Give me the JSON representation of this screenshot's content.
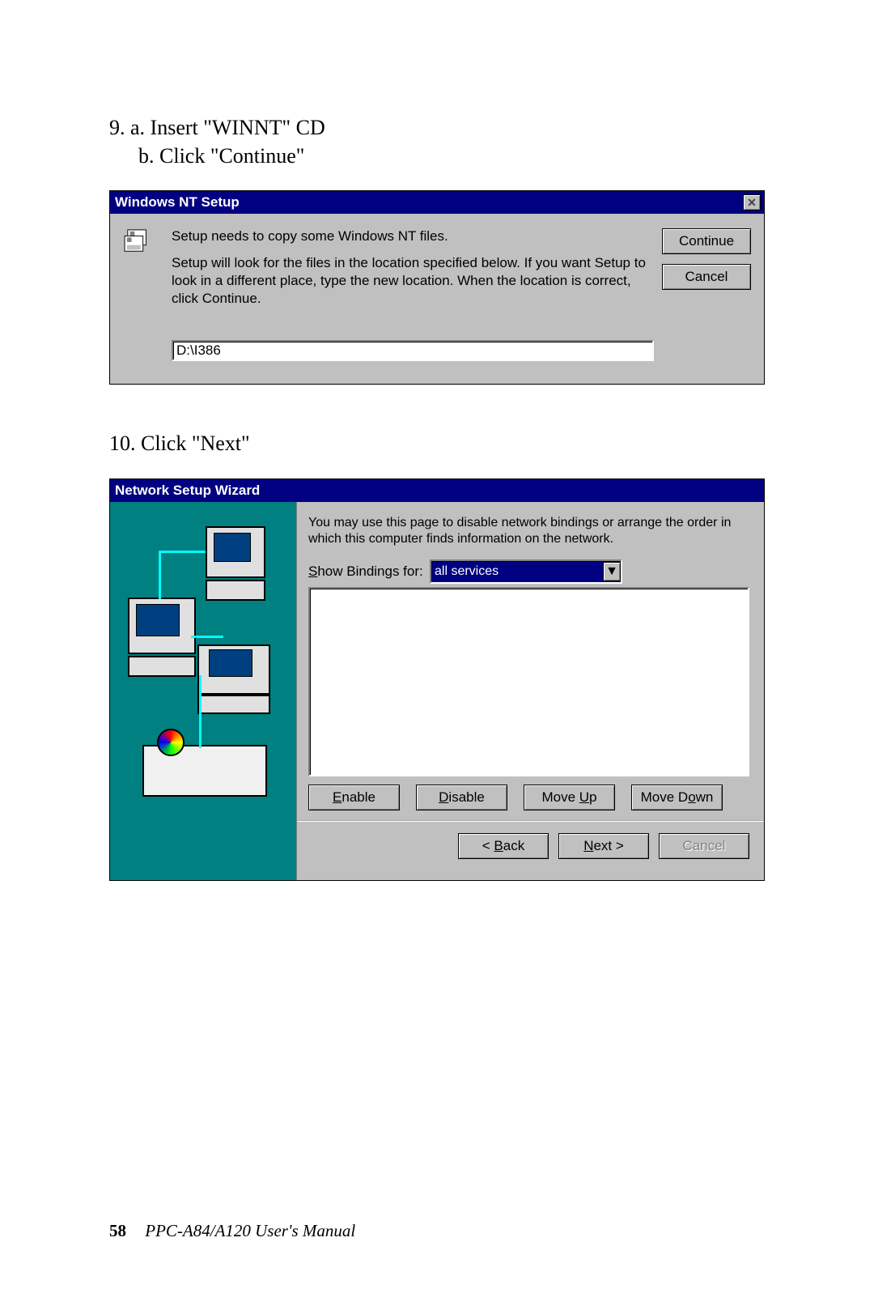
{
  "step9a": "9. a. Insert \"WINNT\" CD",
  "step9b": "b. Click \"Continue\"",
  "step10": "10. Click \"Next\"",
  "dialog1": {
    "title": "Windows NT Setup",
    "msg1": "Setup needs to copy some Windows NT files.",
    "msg2": "Setup will look for the files in the location specified below. If you want Setup to look in a different place, type the new location. When the location is correct, click Continue.",
    "path": "D:\\I386",
    "continue": "Continue",
    "cancel": "Cancel"
  },
  "dialog2": {
    "title": "Network Setup Wizard",
    "desc": "You may use this page to disable network bindings or arrange the order in which this computer finds information on the network.",
    "show_label": "Show Bindings for:",
    "combo_value": "all services",
    "enable": "Enable",
    "disable": "Disable",
    "moveup": "Move Up",
    "movedown": "Move Down",
    "back": "< Back",
    "next": "Next >",
    "cancel": "Cancel"
  },
  "footer": {
    "page": "58",
    "manual": "PPC-A84/A120 User's Manual"
  }
}
